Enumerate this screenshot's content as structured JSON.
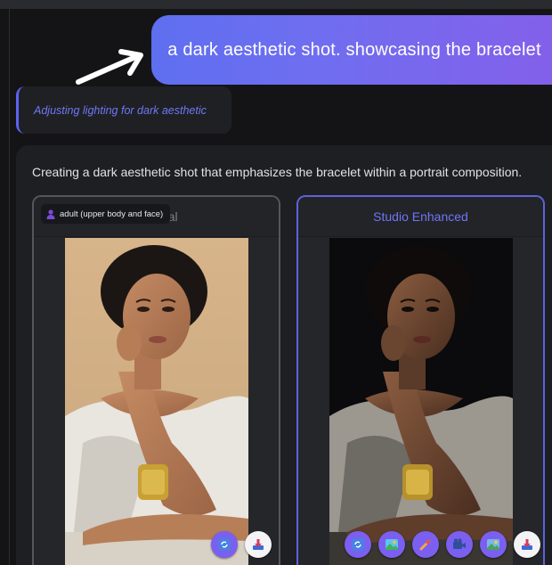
{
  "chat": {
    "user_message": "a dark aesthetic shot. showcasing the bracelet",
    "status": "Adjusting lighting for dark aesthetic",
    "response": "Creating a dark aesthetic shot that emphasizes the bracelet within a portrait composition."
  },
  "comparison": {
    "original": {
      "title": "Original",
      "tag": "adult (upper body and face)",
      "actions": [
        "refresh-icon",
        "download-icon"
      ]
    },
    "enhanced": {
      "title": "Studio Enhanced",
      "actions": [
        "refresh-icon",
        "image-color-icon",
        "magic-wand-icon",
        "camera-icon",
        "image-icon",
        "download-icon"
      ]
    }
  },
  "colors": {
    "accent": "#6b6ff2",
    "bubble_gradient_start": "#5e6ff0",
    "bubble_gradient_end": "#8360ea",
    "panel_bg": "#1e1f22"
  }
}
